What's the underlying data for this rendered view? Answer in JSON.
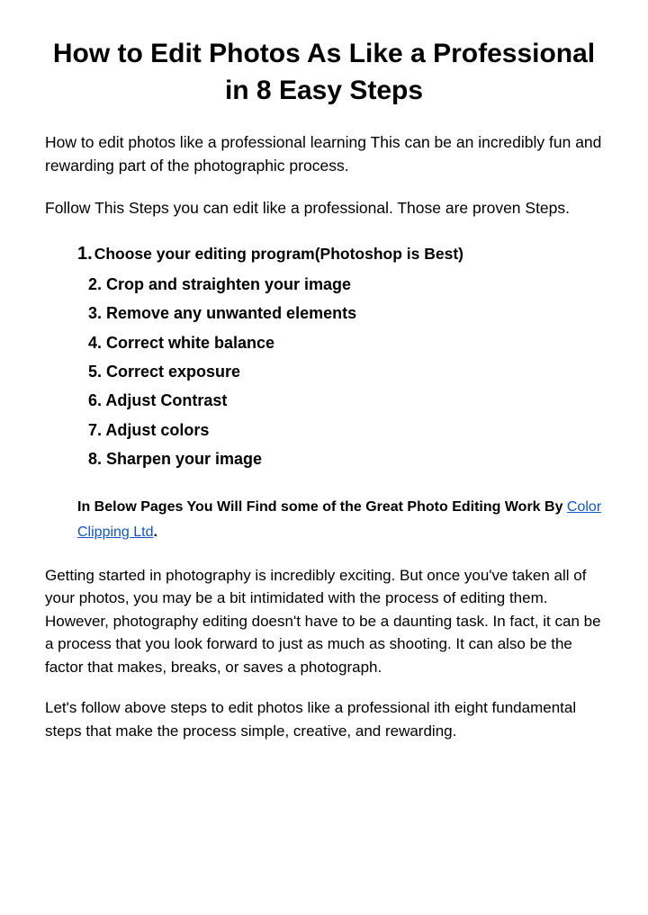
{
  "title": "How to Edit Photos As Like a Professional in 8 Easy Steps",
  "intro1": "How to edit photos like a professional learning This can be an incredibly fun and rewarding part of the photographic process.",
  "intro2": "Follow This Steps you can edit like a professional. Those are proven Steps.",
  "steps": {
    "firstNum": "1.",
    "firstText": "Choose your editing program(Photoshop is Best)",
    "items": [
      "2. Crop and straighten your image",
      "3. Remove any unwanted elements",
      "4. Correct white balance",
      "5. Correct exposure",
      "6. Adjust Contrast",
      "7. Adjust colors",
      "8. Sharpen your image"
    ]
  },
  "calloutPrefix": "In Below Pages You Will Find  some of the Great Photo Editing Work By ",
  "calloutLink": "Color Clipping Ltd",
  "calloutSuffix": ".",
  "body1": "Getting started in photography is incredibly exciting. But once you've taken all of your photos, you may be a bit intimidated with the process of editing them. However, photography editing doesn't have to be a daunting task. In fact, it can be a process that you look forward to just as much as shooting. It can also be the factor that makes, breaks, or saves a photograph.",
  "body2": "Let's follow above steps  to edit photos like a professional ith eight fundamental steps that make the process simple, creative, and rewarding."
}
